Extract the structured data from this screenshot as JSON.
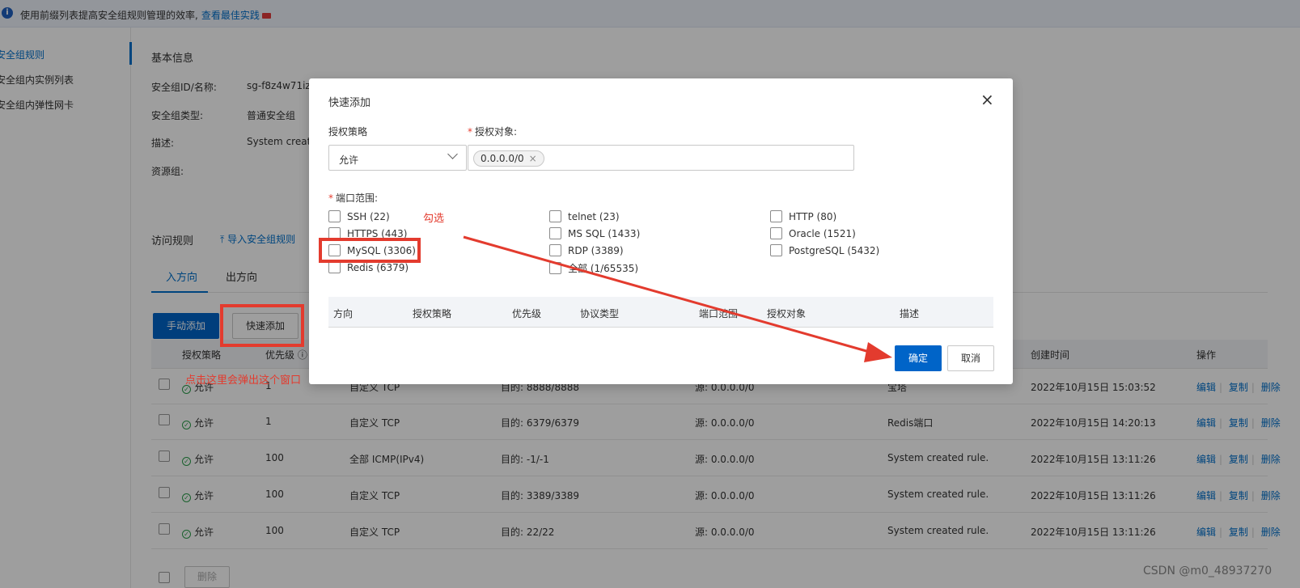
{
  "notice": {
    "text": "使用前缀列表提高安全组规则管理的效率,",
    "link": "查看最佳实践"
  },
  "sidebar": {
    "items": [
      {
        "label": "安全组规则"
      },
      {
        "label": "安全组内实例列表"
      },
      {
        "label": "安全组内弹性网卡"
      }
    ]
  },
  "basic": {
    "title": "基本信息",
    "rows": [
      {
        "label": "安全组ID/名称:",
        "value": "sg-f8z4w71iz"
      },
      {
        "label": "安全组类型:",
        "value": "普通安全组"
      },
      {
        "label": "描述:",
        "value": "System create"
      },
      {
        "label": "资源组:",
        "value": ""
      }
    ]
  },
  "access": {
    "title": "访问规则",
    "import_label": "导入安全组规则",
    "tabs": [
      {
        "label": "入方向"
      },
      {
        "label": "出方向"
      }
    ],
    "manual_add": "手动添加",
    "quick_add": "快速添加",
    "delete_label": "删除"
  },
  "table": {
    "headers": {
      "policy": "授权策略",
      "priority": "优先级",
      "create_time": "创建时间",
      "ops": "操作"
    },
    "rows": [
      {
        "policy": "允许",
        "priority": "1",
        "protocol": "自定义 TCP",
        "port": "目的: 8888/8888",
        "source": "源: 0.0.0.0/0",
        "desc": "宝塔",
        "time": "2022年10月15日 15:03:52"
      },
      {
        "policy": "允许",
        "priority": "1",
        "protocol": "自定义 TCP",
        "port": "目的: 6379/6379",
        "source": "源: 0.0.0.0/0",
        "desc": "Redis端口",
        "time": "2022年10月15日 14:20:13"
      },
      {
        "policy": "允许",
        "priority": "100",
        "protocol": "全部 ICMP(IPv4)",
        "port": "目的: -1/-1",
        "source": "源: 0.0.0.0/0",
        "desc": "System created rule.",
        "time": "2022年10月15日 13:11:26"
      },
      {
        "policy": "允许",
        "priority": "100",
        "protocol": "自定义 TCP",
        "port": "目的: 3389/3389",
        "source": "源: 0.0.0.0/0",
        "desc": "System created rule.",
        "time": "2022年10月15日 13:11:26"
      },
      {
        "policy": "允许",
        "priority": "100",
        "protocol": "自定义 TCP",
        "port": "目的: 22/22",
        "source": "源: 0.0.0.0/0",
        "desc": "System created rule.",
        "time": "2022年10月15日 13:11:26"
      }
    ],
    "op_labels": {
      "edit": "编辑",
      "copy": "复制",
      "delete": "删除"
    }
  },
  "modal": {
    "title": "快速添加",
    "close": "×",
    "policy_label": "授权策略",
    "policy_value": "允许",
    "target_label": "授权对象:",
    "target_chip": "0.0.0.0/0",
    "ports_label": "端口范围:",
    "ports": [
      {
        "label": "SSH (22)"
      },
      {
        "label": "telnet (23)"
      },
      {
        "label": "HTTP (80)"
      },
      {
        "label": "HTTPS (443)"
      },
      {
        "label": "MS SQL (1433)"
      },
      {
        "label": "Oracle (1521)"
      },
      {
        "label": "MySQL (3306)"
      },
      {
        "label": "RDP (3389)"
      },
      {
        "label": "PostgreSQL (5432)"
      },
      {
        "label": "Redis (6379)"
      },
      {
        "label": "全部 (1/65535)"
      }
    ],
    "table_headers": [
      "方向",
      "授权策略",
      "优先级",
      "协议类型",
      "端口范围",
      "授权对象",
      "描述"
    ],
    "ok": "确定",
    "cancel": "取消"
  },
  "annotations": {
    "check_hint": "勾选",
    "click_hint": "点击这里会弹出这个窗口",
    "color": "#e33b2e"
  },
  "watermark": "CSDN @m0_48937270"
}
